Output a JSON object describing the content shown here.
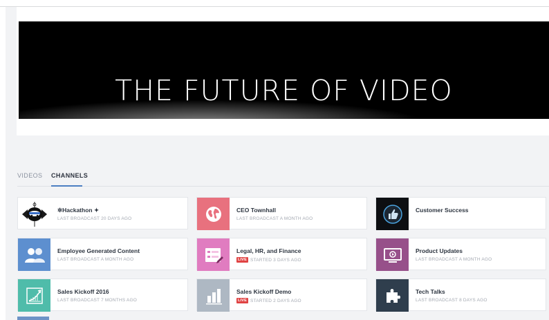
{
  "hero": {
    "title": "THE FUTURE OF VIDEO"
  },
  "tabs": [
    {
      "label": "VIDEOS",
      "active": false
    },
    {
      "label": "CHANNELS",
      "active": true
    }
  ],
  "channels": [
    {
      "title": "✲Hackathon ✦",
      "subtitle": "LAST BROADCAST 20 DAYS AGO",
      "live": false,
      "thumb_color": "#ffffff",
      "icon": "hackathon-logo-icon"
    },
    {
      "title": "CEO Townhall",
      "subtitle": "LAST BROADCAST A MONTH AGO",
      "live": false,
      "thumb_color": "#e8717e",
      "icon": "globe-icon"
    },
    {
      "title": "Customer Success",
      "subtitle": "",
      "live": false,
      "thumb_color": "#0d0f12",
      "icon": "thumbs-up-icon"
    },
    {
      "title": "Employee Generated Content",
      "subtitle": "LAST BROADCAST A MONTH AGO",
      "live": false,
      "thumb_color": "#5d8fcf",
      "icon": "people-icon"
    },
    {
      "title": "Legal, HR, and Finance",
      "subtitle": "STARTED 3 DAYS AGO",
      "live": true,
      "live_label": "LIVE",
      "thumb_color": "#e07cc0",
      "icon": "form-edit-icon"
    },
    {
      "title": "Product Updates",
      "subtitle": "LAST BROADCAST A MONTH AGO",
      "live": false,
      "thumb_color": "#97508a",
      "icon": "monitor-play-icon"
    },
    {
      "title": "Sales Kickoff 2016",
      "subtitle": "LAST BROADCAST 7 MONTHS AGO",
      "live": false,
      "thumb_color": "#4fbcaa",
      "icon": "growth-chart-icon"
    },
    {
      "title": "Sales Kickoff Demo",
      "subtitle": "STARTED 2 DAYS AGO",
      "live": true,
      "live_label": "LIVE",
      "thumb_color": "#aeb8c3",
      "icon": "bar-chart-icon"
    },
    {
      "title": "Tech Talks",
      "subtitle": "LAST BROADCAST 8 DAYS AGO",
      "live": false,
      "thumb_color": "#2f3e4d",
      "icon": "puzzle-icon"
    }
  ]
}
